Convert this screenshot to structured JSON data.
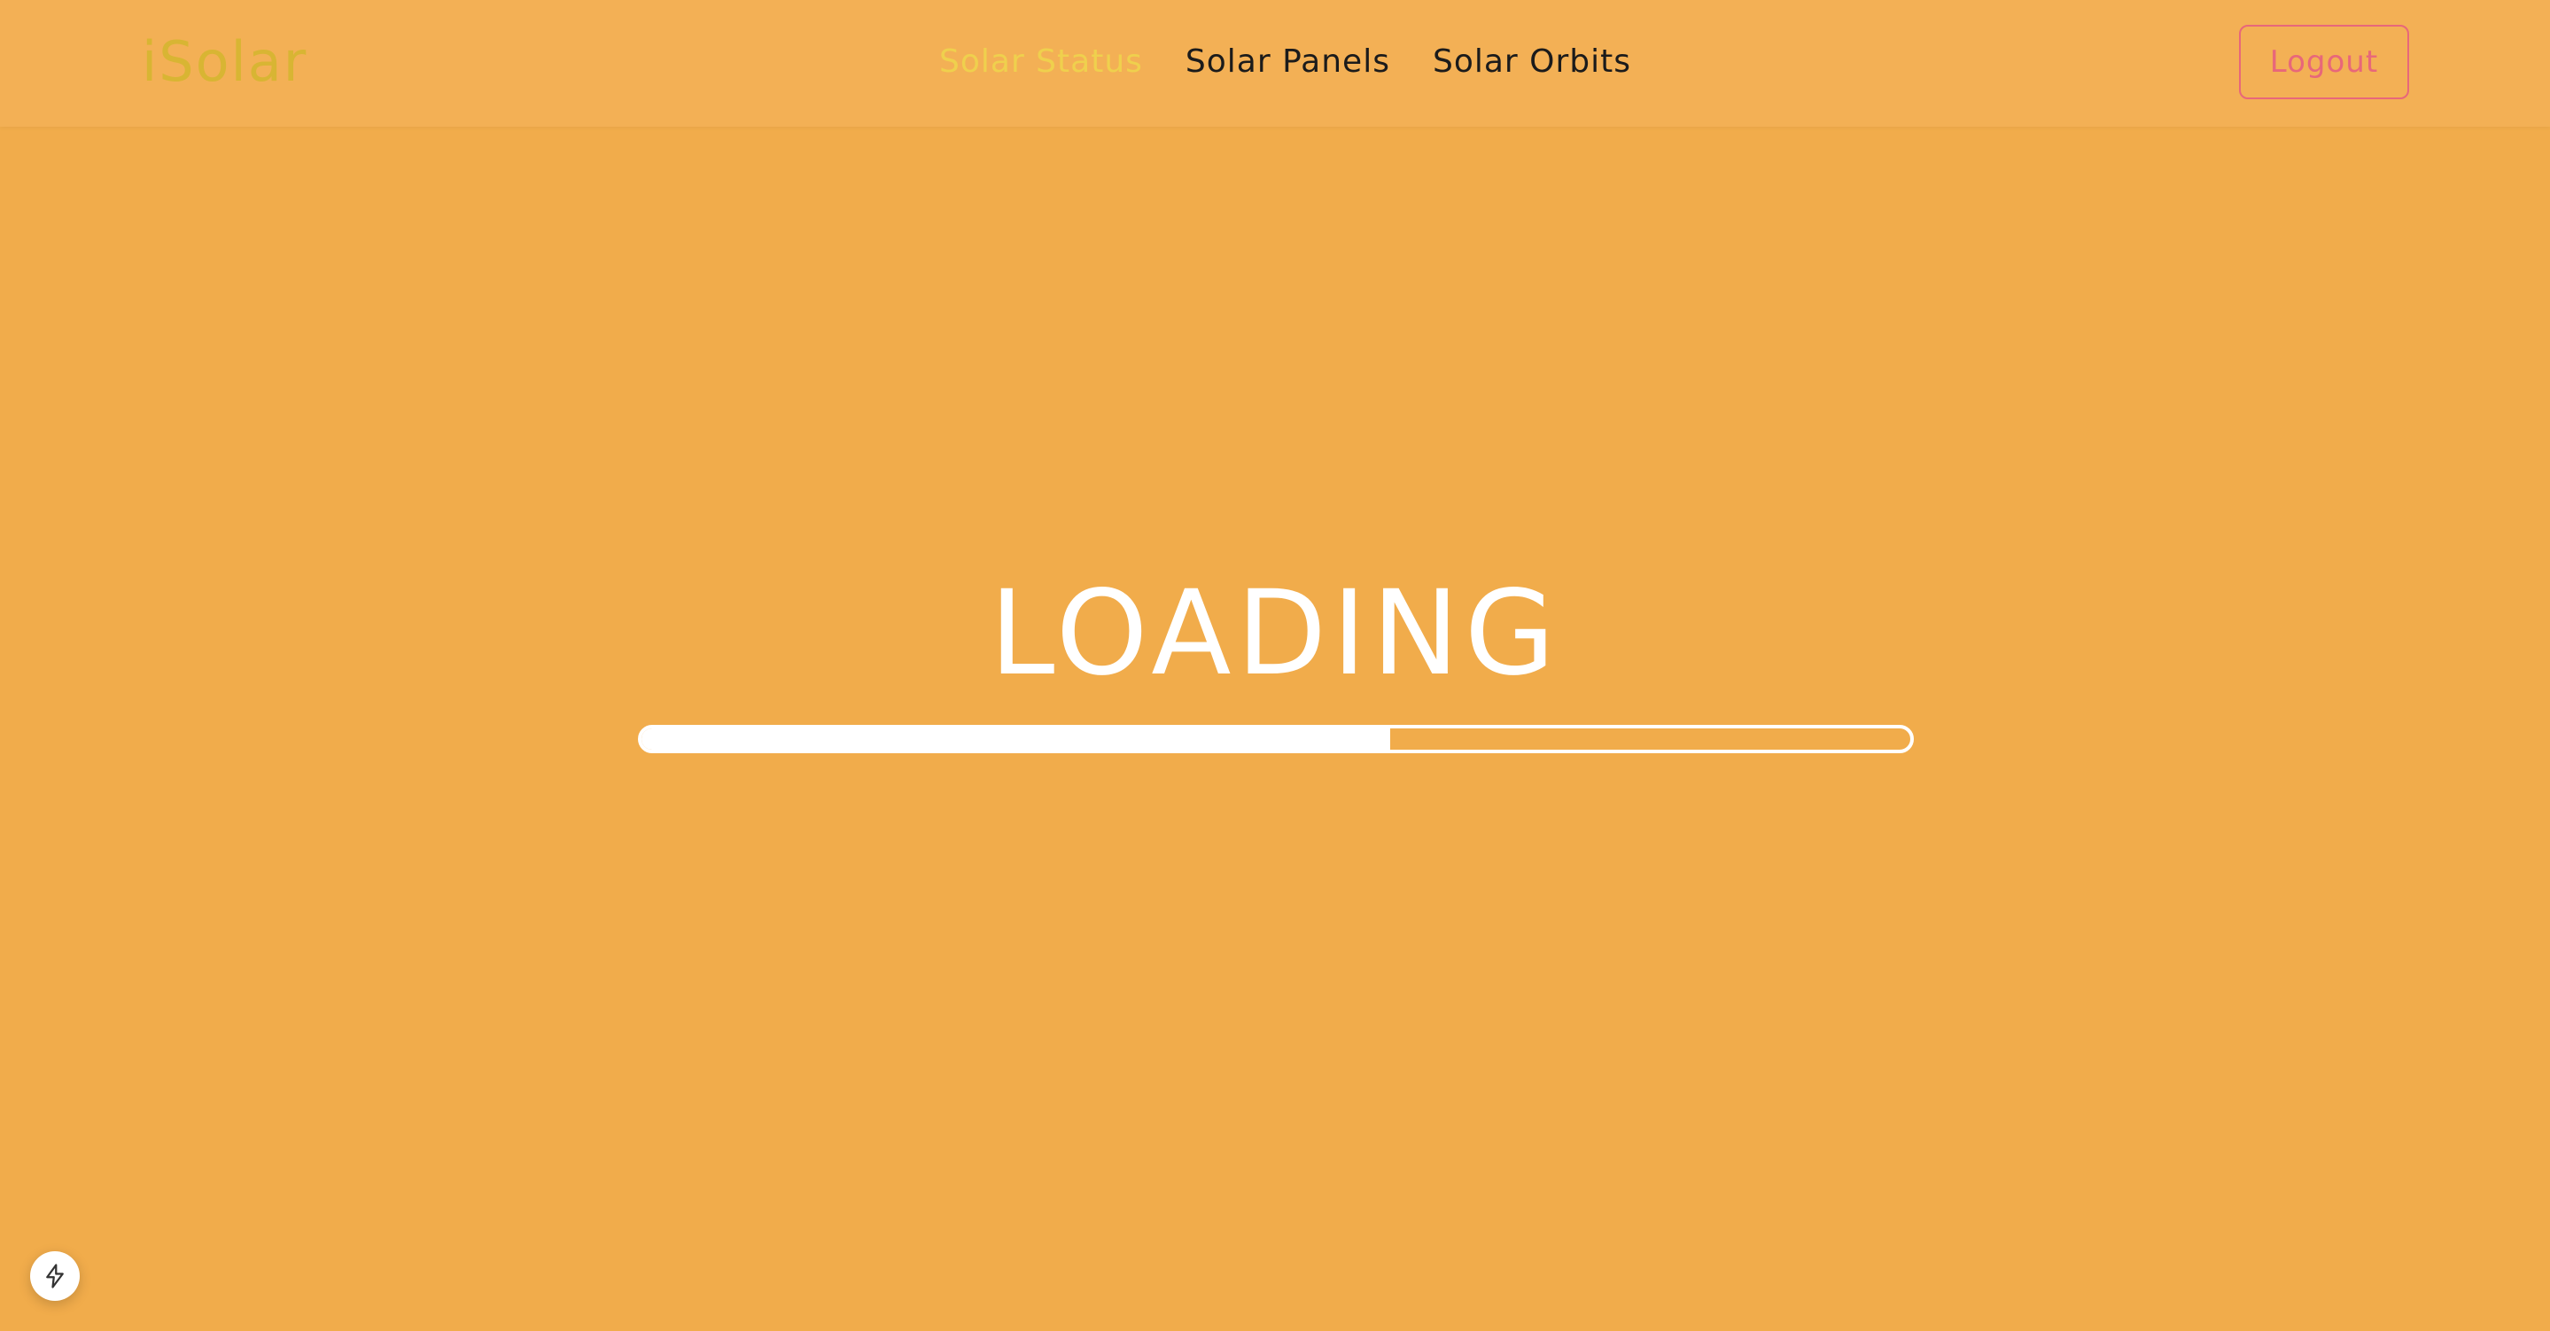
{
  "app": {
    "brand": "iSolar"
  },
  "nav": {
    "items": [
      {
        "label": "Solar Status",
        "active": true
      },
      {
        "label": "Solar Panels",
        "active": false
      },
      {
        "label": "Solar Orbits",
        "active": false
      }
    ]
  },
  "header": {
    "logout_label": "Logout"
  },
  "main": {
    "loading_text": "LOADING",
    "progress": 0.59
  },
  "colors": {
    "background": "#f1ac4b",
    "topbar": "#f3b055",
    "brand": "#d8b533",
    "nav_active": "#efd04d",
    "nav_inactive": "#1b1b1b",
    "logout_accent": "#e8677a",
    "progress": "#ffffff"
  },
  "icons": {
    "fab": "lightning-bolt-icon"
  }
}
